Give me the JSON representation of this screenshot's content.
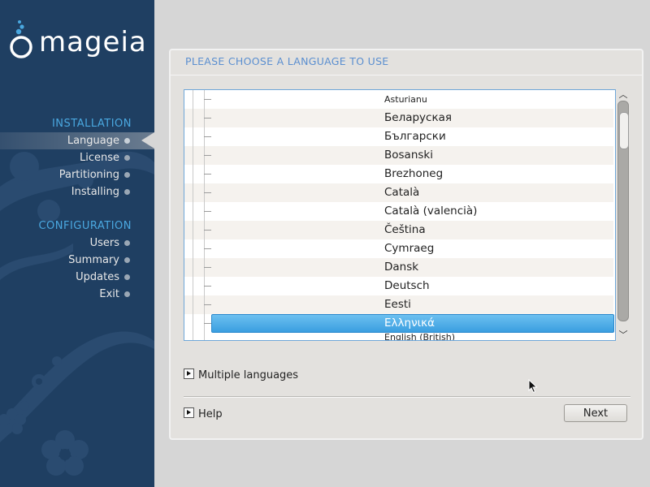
{
  "sidebar": {
    "logo_text": "mageia",
    "sections": [
      {
        "title": "INSTALLATION",
        "steps": [
          "Language",
          "License",
          "Partitioning",
          "Installing"
        ]
      },
      {
        "title": "CONFIGURATION",
        "steps": [
          "Users",
          "Summary",
          "Updates",
          "Exit"
        ]
      }
    ],
    "active_step": "Language"
  },
  "panel": {
    "title": "PLEASE CHOOSE A LANGUAGE TO USE",
    "languages": [
      "Asturianu",
      "Беларуская",
      "Български",
      "Bosanski",
      "Brezhoneg",
      "Català",
      "Català (valencià)",
      "Čeština",
      "Cymraeg",
      "Dansk",
      "Deutsch",
      "Eesti",
      "Ελληνικά",
      "English (British)"
    ],
    "selected_language": "Ελληνικά",
    "multiple_languages_label": "Multiple languages",
    "help_label": "Help",
    "next_label": "Next"
  },
  "colors": {
    "sidebar_bg": "#1f3f62",
    "section_title": "#4aa8e0",
    "panel_title": "#5b8fd0",
    "selection": "#3a9ee0"
  }
}
